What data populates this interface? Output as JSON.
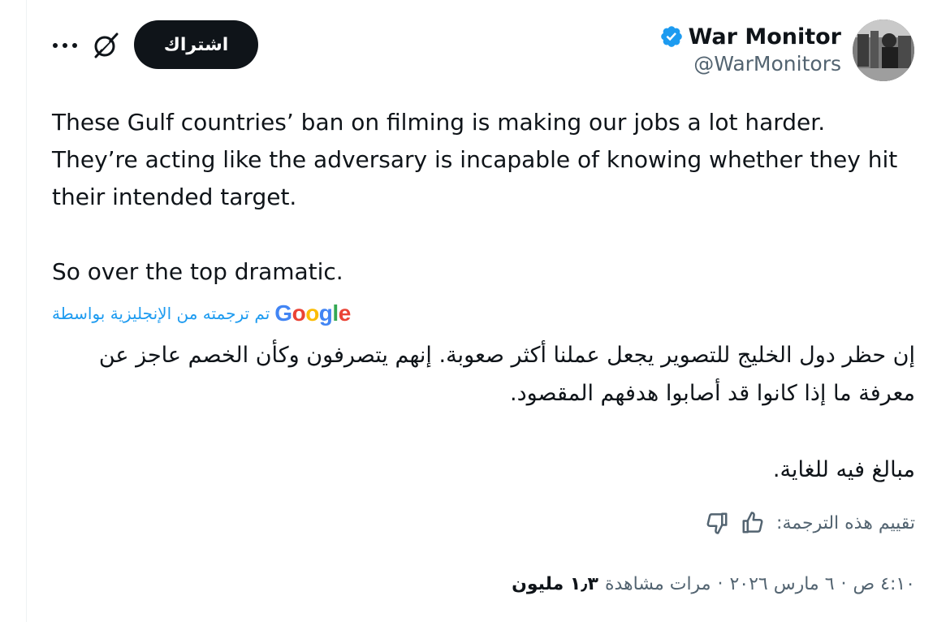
{
  "header": {
    "display_name": "War Monitor",
    "handle": "@WarMonitors",
    "subscribe_label": "اشتراك",
    "verified_color": "#1d9bf0"
  },
  "tweet": {
    "text": "These Gulf countries’ ban on filming is making our jobs a lot harder. They’re acting like the adversary is incapable of knowing whether they hit their intended target.\n\nSo over the top dramatic."
  },
  "translation": {
    "provider": "Google",
    "translated_label": "تم ترجمته من الإنجليزية بواسطة",
    "text": "إن حظر دول الخليج للتصوير يجعل عملنا أكثر صعوبة. إنهم يتصرفون وكأن الخصم عاجز عن معرفة ما إذا كانوا قد أصابوا هدفهم المقصود.\n\nمبالغ فيه للغاية.",
    "rate_label": "تقييم هذه الترجمة:"
  },
  "meta": {
    "time": "٤:١٠ ص",
    "date": "٦ مارس ٢٠٢٦",
    "views_count": "١٫٣ مليون",
    "views_label": "مرات مشاهدة",
    "separator": "·"
  },
  "icons": {
    "more": "more-horizontal-icon",
    "grok": "grok-icon",
    "thumbs_up": "thumbs-up-icon",
    "thumbs_down": "thumbs-down-icon",
    "verified": "verified-badge-icon"
  }
}
